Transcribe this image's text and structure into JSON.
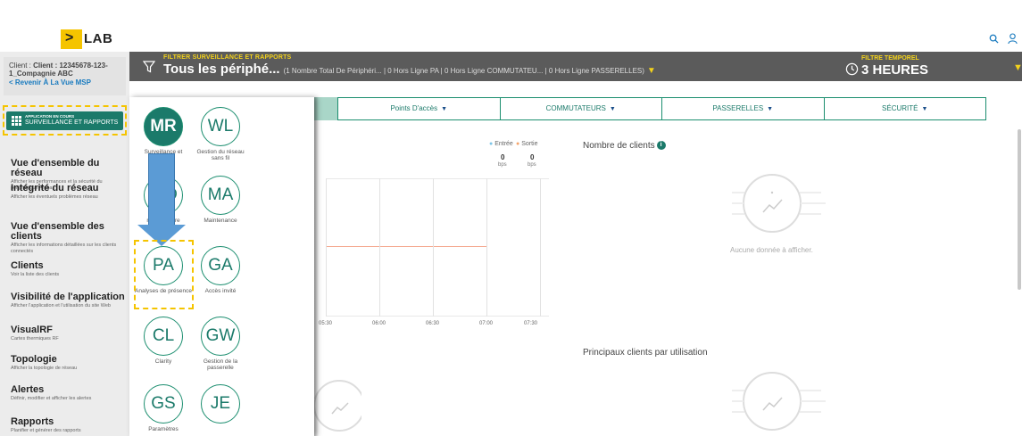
{
  "header": {
    "logo_text": "LAB",
    "logo_symbol": ">",
    "icons": [
      "search-icon",
      "user-icon"
    ]
  },
  "filterbar": {
    "caption": "FILTRER SURVEILLANCE ET RAPPORTS",
    "title": "Tous les périphé...",
    "detail": "(1 Nombre Total De Périphéri... | 0 Hors Ligne PA | 0 Hors Ligne COMMUTATEU... | 0 Hors Ligne PASSERELLES)",
    "time_caption": "FILTRE TEMPOREL",
    "time_value": "3 HEURES"
  },
  "client": {
    "line1": "Client : 12345678-123-",
    "line2": "1_Compagnie ABC",
    "back": "Revenir À La Vue MSP"
  },
  "app_running": {
    "caption": "APPLICATION EN COURS",
    "name": "SURVEILLANCE ET RAPPORTS"
  },
  "nav": [
    {
      "title": "Vue d'ensemble du réseau",
      "desc": "Afficher les performances et la sécurité du périphérique Aruba"
    },
    {
      "title": "Intégrité du réseau",
      "desc": "Afficher les éventuels problèmes réseau"
    },
    {
      "title": "Vue d'ensemble des clients",
      "desc": "Afficher les informations détaillées sur les clients connectés"
    },
    {
      "title": "Clients",
      "desc": "Voir la liste des clients"
    },
    {
      "title": "Visibilité de l'application",
      "desc": "Afficher l'application et l'utilisation du site Web"
    },
    {
      "title": "VisualRF",
      "desc": "Cartes thermiques RF"
    },
    {
      "title": "Topologie",
      "desc": "Afficher la topologie de réseau"
    },
    {
      "title": "Alertes",
      "desc": "Définir, modifier et afficher les alertes"
    },
    {
      "title": "Rapports",
      "desc": "Planifier et générer des rapports"
    }
  ],
  "tabs": [
    "Points D'accès",
    "COMMUTATEURS",
    "PASSERELLES",
    "SÉCURITÉ"
  ],
  "chart": {
    "legend": [
      "Entrée",
      "Sortie"
    ],
    "values": [
      "0",
      "0"
    ],
    "units": [
      "bps",
      "bps"
    ],
    "x_ticks": [
      "05:30",
      "06:00",
      "06:30",
      "07:00",
      "07:30"
    ]
  },
  "panels": {
    "clients_title": "Nombre de clients",
    "no_data": "Aucune donnée à afficher.",
    "top_clients_title": "Principaux clients par utilisation"
  },
  "apps": [
    {
      "abbr": "MR",
      "label": "Surveillance et rapports",
      "active": true
    },
    {
      "abbr": "WL",
      "label": "Gestion du réseau sans fil",
      "active": false
    },
    {
      "abbr": "WD",
      "label": "réseau filaire",
      "active": false
    },
    {
      "abbr": "MA",
      "label": "Maintenance",
      "active": false
    },
    {
      "abbr": "PA",
      "label": "Analyses de présence",
      "active": false
    },
    {
      "abbr": "GA",
      "label": "Accès invité",
      "active": false
    },
    {
      "abbr": "CL",
      "label": "Clarity",
      "active": false
    },
    {
      "abbr": "GW",
      "label": "Gestion de la passerelle",
      "active": false
    },
    {
      "abbr": "GS",
      "label": "Paramètres",
      "active": false
    },
    {
      "abbr": "JE",
      "label": "",
      "active": false
    }
  ],
  "colors": {
    "accent": "#1b7a6a",
    "highlight": "#f5c400",
    "filterbar": "#5b5b5b",
    "arrow": "#5b9bd5"
  }
}
